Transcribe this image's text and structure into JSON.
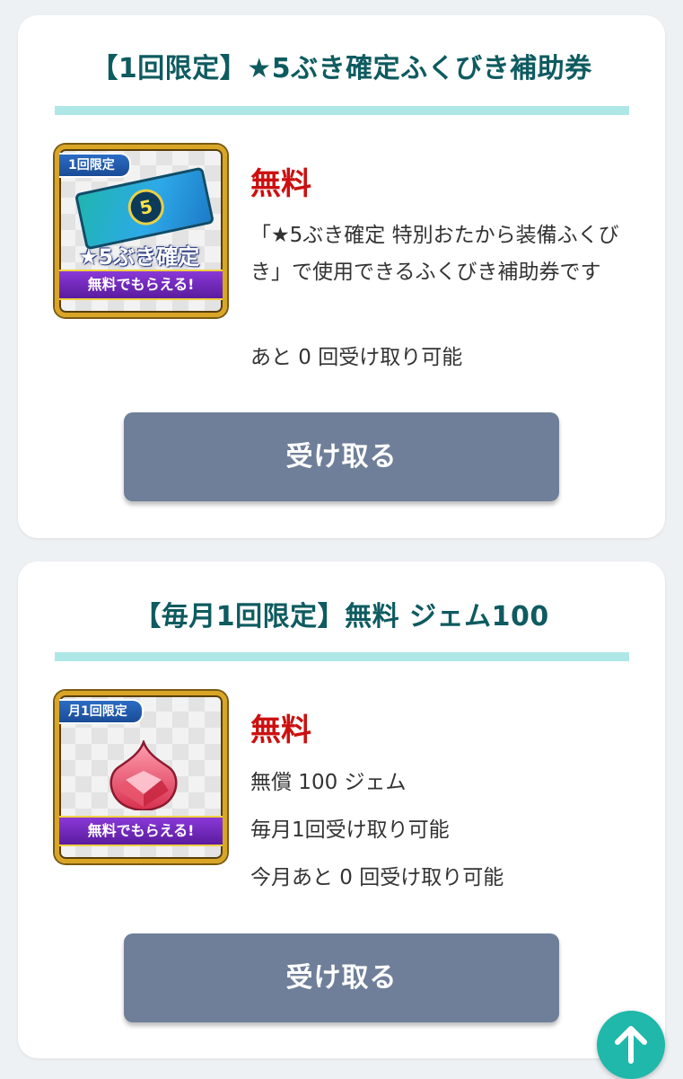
{
  "offers": [
    {
      "title": "【1回限定】★5ぶき確定ふくびき補助券",
      "thumb_tag": "1回限定",
      "thumb_label": "★5ぶき確定",
      "thumb_banner": "無料でもらえる!",
      "price": "無料",
      "description": "「★5ぶき確定 特別おたから装備ふくびき」で使用できるふくびき補助券です",
      "remaining": "あと 0 回受け取り可能",
      "button_label": "受け取る"
    },
    {
      "title": "【毎月1回限定】無料 ジェム100",
      "thumb_tag": "月1回限定",
      "thumb_banner": "無料でもらえる!",
      "price": "無料",
      "line1": "無償 100 ジェム",
      "line2": "毎月1回受け取り可能",
      "remaining": "今月あと 0 回受け取り可能",
      "button_label": "受け取る"
    }
  ],
  "icons": {
    "scroll_top": "arrow-up-icon"
  },
  "colors": {
    "title": "#0e5b60",
    "price": "#cc1010",
    "button": "#6f7f99",
    "divider": "#aee8e6",
    "scroll_top": "#1fb8aa"
  }
}
